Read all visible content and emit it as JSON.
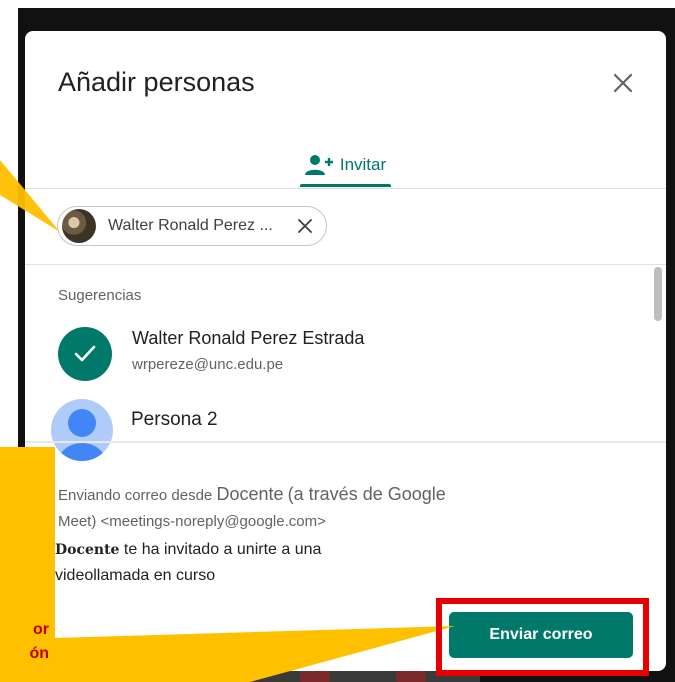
{
  "dialog": {
    "title": "Añadir personas",
    "close_icon": "close-icon"
  },
  "tabs": [
    {
      "label": "Invitar",
      "icon": "person-add-icon",
      "active": true
    }
  ],
  "chip": {
    "label": "Walter Ronald Perez ...",
    "remove_icon": "close-icon"
  },
  "suggestions": {
    "heading": "Sugerencias",
    "items": [
      {
        "name": "Walter Ronald Perez Estrada",
        "email": "wrpereze@unc.edu.pe",
        "selected": true
      },
      {
        "name": "Persona 2",
        "email": "",
        "selected": false
      }
    ]
  },
  "sender": {
    "prefix": "Enviando correo desde",
    "name": "Docente",
    "via": "(a través de Google",
    "service": "Meet) <meetings-noreply@google.com>"
  },
  "invite": {
    "name": "Docente",
    "message_part1": "te ha invitado a unirte a una",
    "message_part2": "videollamada en curso"
  },
  "send_button": {
    "label": "Enviar correo"
  },
  "annotation": {
    "line1": "or",
    "line2": "ón"
  },
  "colors": {
    "accent": "#00796b",
    "highlight": "#e60000",
    "callout": "#ffc000",
    "callout_text": "#c00000"
  }
}
